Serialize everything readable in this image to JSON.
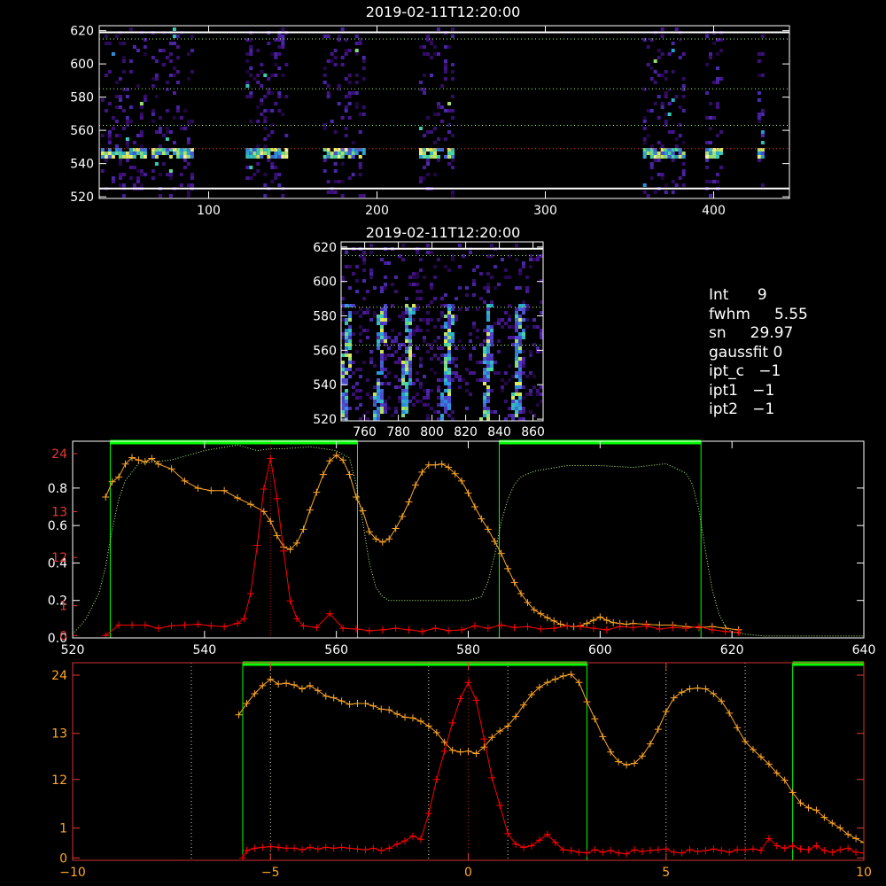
{
  "top_panel": {
    "title": "2019-02-11T12:20:00",
    "x_ticks": [
      "100",
      "200",
      "300",
      "400"
    ],
    "y_ticks": [
      "520",
      "540",
      "560",
      "580",
      "600",
      "620"
    ],
    "xlim": [
      35,
      445
    ],
    "ylim": [
      519,
      623
    ],
    "guide_lines_y": [
      525,
      549,
      563,
      585,
      615
    ],
    "bright_lines_y": [
      525,
      619
    ],
    "exposure_columns": [
      [
        36,
        62
      ],
      [
        66,
        90
      ],
      [
        122,
        146
      ],
      [
        168,
        193
      ],
      [
        225,
        245
      ],
      [
        358,
        383
      ],
      [
        395,
        405
      ],
      [
        426,
        430
      ]
    ],
    "emission_row_y": 548
  },
  "middle_panel": {
    "title": "2019-02-11T12:20:00",
    "x_ticks": [
      "760",
      "780",
      "800",
      "820",
      "840",
      "860"
    ],
    "y_ticks": [
      "520",
      "540",
      "560",
      "580",
      "600",
      "620"
    ],
    "xlim": [
      746,
      866
    ],
    "ylim": [
      519,
      623
    ],
    "guide_lines_y": [
      563,
      585,
      615
    ],
    "bright_lines_y": [
      619
    ]
  },
  "info": {
    "int_label": "Int",
    "int_value": "9",
    "fwhm_label": "fwhm",
    "fwhm_value": "5.55",
    "sn_label": "sn",
    "sn_value": "29.97",
    "gaussfit_label": "gaussfit",
    "gaussfit_value": "0",
    "ipt_c_label": "ipt_c",
    "ipt_c_value": "−1",
    "ipt1_label": "ipt1",
    "ipt1_value": "−1",
    "ipt2_label": "ipt2",
    "ipt2_value": "−1"
  },
  "colors": {
    "background": "#000000",
    "axes": "#ffffff",
    "spectrum_series": "#ff0000",
    "continuum_series": "#ffa726",
    "filter_curve": "#b5ff7a",
    "filter_band": "#00ff00",
    "guide_lines": "#9aff66"
  },
  "chart_data": [
    {
      "type": "line",
      "panel": "spectrum-vs-wavelength",
      "xlim": [
        520,
        640
      ],
      "x_ticks": [
        "520",
        "540",
        "560",
        "580",
        "600",
        "620",
        "640"
      ],
      "ylim_left": [
        0,
        1.05
      ],
      "y_ticks_left": [
        "0.0",
        "0.2",
        "0.4",
        "0.6",
        "0.8"
      ],
      "y_ticks_left_values": [
        0,
        0.2,
        0.4,
        0.6,
        0.8
      ],
      "ylim_right": [
        0,
        24
      ],
      "y_ticks_right": [
        "0",
        "1",
        "12",
        "13",
        "24"
      ],
      "y_ticks_right_values": [
        0.3,
        4,
        10,
        15.7,
        22.9
      ],
      "filter_bands": [
        [
          525.7,
          563.2
        ],
        [
          584.7,
          615.3
        ]
      ],
      "red_marker_x": 550,
      "series": [
        {
          "color": "red",
          "x": [
            525,
            527,
            529,
            531,
            533,
            535,
            537,
            539,
            541,
            543,
            545,
            546,
            547,
            548,
            549,
            550,
            551,
            552,
            553,
            554,
            555,
            557,
            559,
            561,
            563,
            565,
            567,
            569,
            571,
            573,
            575,
            577,
            579,
            581,
            583,
            585,
            587,
            589,
            591,
            593,
            595,
            597,
            599,
            601,
            603,
            605,
            607,
            609,
            611,
            613,
            615,
            617,
            619,
            621
          ],
          "values": [
            0.3,
            1.6,
            1.6,
            1.6,
            1.2,
            1.5,
            1.6,
            1.7,
            1.5,
            1.4,
            1.8,
            2.4,
            5.5,
            11.5,
            18.5,
            22.3,
            17.3,
            10.8,
            4.6,
            2.4,
            1.5,
            1.3,
            3.0,
            1.2,
            1.1,
            0.9,
            1.0,
            1.2,
            1.0,
            0.8,
            1.2,
            0.9,
            1.0,
            1.5,
            1.2,
            1.6,
            1.3,
            1.4,
            1.1,
            1.2,
            1.5,
            1.4,
            1.2,
            1.0,
            1.4,
            1.3,
            1.5,
            1.1,
            1.3,
            1.2,
            1.4,
            1.0,
            0.8,
            0.7
          ]
        },
        {
          "color": "orange",
          "x": [
            525,
            526,
            527,
            528,
            529,
            530,
            531,
            532,
            533,
            535,
            537,
            539,
            541,
            543,
            545,
            547,
            549,
            550,
            551,
            552,
            553,
            554,
            555,
            556,
            557,
            558,
            559,
            560,
            561,
            562,
            563,
            564,
            565,
            566,
            567,
            568,
            569,
            570,
            571,
            572,
            573,
            574,
            575,
            576,
            577,
            578,
            579,
            580,
            581,
            582,
            583,
            584,
            585,
            586,
            587,
            588,
            589,
            590,
            591,
            592,
            593,
            594,
            595,
            596,
            597,
            598,
            599,
            600,
            601,
            602,
            603,
            604,
            605,
            607,
            609,
            611,
            613,
            615,
            617,
            619,
            621
          ],
          "values": [
            17.5,
            19.4,
            20.0,
            21.6,
            22.4,
            22.1,
            21.9,
            22.3,
            21.6,
            21.0,
            19.5,
            18.6,
            18.3,
            18.3,
            17.4,
            16.6,
            15.7,
            14.5,
            12.7,
            11.3,
            11.0,
            11.8,
            13.5,
            15.9,
            18.1,
            20.3,
            22.0,
            22.7,
            22.1,
            20.3,
            17.5,
            15.8,
            13.2,
            12.3,
            11.9,
            12.3,
            13.6,
            15.1,
            16.9,
            19.0,
            20.6,
            21.5,
            21.5,
            21.6,
            21.2,
            20.4,
            19.5,
            18.0,
            16.3,
            14.8,
            13.5,
            12.0,
            10.5,
            8.6,
            6.9,
            5.5,
            4.4,
            3.5,
            3.0,
            2.5,
            2.1,
            1.7,
            1.5,
            1.4,
            1.5,
            1.8,
            2.2,
            2.6,
            2.2,
            1.9,
            1.8,
            1.7,
            1.8,
            1.7,
            1.6,
            1.6,
            1.4,
            1.3,
            1.4,
            1.2,
            1.0
          ]
        },
        {
          "color": "green-dotted",
          "axis": "left",
          "x": [
            520,
            522,
            524,
            525,
            526,
            527,
            528,
            530,
            535,
            540,
            545,
            548,
            550,
            552,
            556,
            560,
            562,
            563,
            564,
            565,
            566,
            567,
            568,
            570,
            575,
            580,
            582,
            583,
            584,
            585,
            586,
            587,
            588,
            590,
            595,
            600,
            605,
            610,
            613,
            614,
            615,
            616,
            617,
            618,
            619,
            620,
            622,
            625,
            630,
            640
          ],
          "values": [
            0.02,
            0.1,
            0.24,
            0.38,
            0.58,
            0.74,
            0.84,
            0.93,
            0.95,
            1.0,
            1.03,
            1.0,
            1.01,
            1.01,
            1.02,
            1.0,
            0.96,
            0.82,
            0.62,
            0.4,
            0.27,
            0.22,
            0.2,
            0.2,
            0.2,
            0.2,
            0.22,
            0.3,
            0.44,
            0.62,
            0.74,
            0.82,
            0.86,
            0.89,
            0.92,
            0.92,
            0.91,
            0.93,
            0.88,
            0.82,
            0.68,
            0.46,
            0.26,
            0.13,
            0.06,
            0.03,
            0.02,
            0.01,
            0.01,
            0.01
          ]
        }
      ]
    },
    {
      "type": "line",
      "panel": "spectrum-vs-offset",
      "xlim": [
        -10,
        10
      ],
      "x_ticks": [
        "−10",
        "−5",
        "0",
        "5",
        "10"
      ],
      "ylim": [
        0,
        24
      ],
      "y_ticks": [
        "0",
        "1",
        "12",
        "13",
        "24"
      ],
      "y_ticks_values": [
        0.3,
        4,
        10,
        15.7,
        22.9
      ],
      "filter_bands": [
        [
          -5.7,
          3.0
        ],
        [
          8.2,
          10
        ]
      ],
      "marker_lines_x": [
        -7,
        -5,
        -1,
        0,
        1,
        5,
        7
      ],
      "series": [
        {
          "color": "red",
          "x": [
            -5.7,
            -5.6,
            -5.4,
            -5.2,
            -5.0,
            -4.8,
            -4.6,
            -4.4,
            -4.2,
            -4.0,
            -3.8,
            -3.6,
            -3.4,
            -3.2,
            -3.0,
            -2.8,
            -2.6,
            -2.4,
            -2.2,
            -2.0,
            -1.8,
            -1.6,
            -1.4,
            -1.2,
            -1.0,
            -0.8,
            -0.6,
            -0.4,
            -0.2,
            0.0,
            0.2,
            0.4,
            0.6,
            0.8,
            1.0,
            1.2,
            1.4,
            1.6,
            1.8,
            2.0,
            2.2,
            2.4,
            2.6,
            2.8,
            3.0,
            3.2,
            3.4,
            3.6,
            3.8,
            4.0,
            4.2,
            4.4,
            4.6,
            4.8,
            5.0,
            5.2,
            5.4,
            5.6,
            5.8,
            6.0,
            6.2,
            6.4,
            6.6,
            6.8,
            7.0,
            7.2,
            7.4,
            7.6,
            7.8,
            8.0,
            8.2,
            8.4,
            8.6,
            8.8,
            9.0,
            9.2,
            9.4,
            9.6,
            9.8,
            10.0
          ],
          "values": [
            0.3,
            1.2,
            1.5,
            1.6,
            1.7,
            1.6,
            1.5,
            1.5,
            1.3,
            1.6,
            1.4,
            1.6,
            1.5,
            1.6,
            1.5,
            1.4,
            1.3,
            1.5,
            1.2,
            1.5,
            2.0,
            2.4,
            3.0,
            2.6,
            5.8,
            10.0,
            13.5,
            17.0,
            20.0,
            22.0,
            19.8,
            15.0,
            10.2,
            6.8,
            3.3,
            2.0,
            1.6,
            1.8,
            2.5,
            3.2,
            2.2,
            1.3,
            1.2,
            1.0,
            0.9,
            1.3,
            1.0,
            1.2,
            0.9,
            0.8,
            1.3,
            1.1,
            1.2,
            1.3,
            1.4,
            1.0,
            0.9,
            1.3,
            1.1,
            1.2,
            1.4,
            1.2,
            1.0,
            1.3,
            1.3,
            1.4,
            1.2,
            2.7,
            1.8,
            1.5,
            1.8,
            1.4,
            1.3,
            1.8,
            1.2,
            1.0,
            1.3,
            1.5,
            1.0,
            0.9
          ]
        },
        {
          "color": "orange",
          "x": [
            -5.8,
            -5.6,
            -5.4,
            -5.2,
            -5.0,
            -4.8,
            -4.6,
            -4.4,
            -4.2,
            -4.0,
            -3.8,
            -3.6,
            -3.4,
            -3.2,
            -3.0,
            -2.8,
            -2.6,
            -2.4,
            -2.2,
            -2.0,
            -1.8,
            -1.6,
            -1.4,
            -1.2,
            -1.0,
            -0.8,
            -0.6,
            -0.4,
            -0.2,
            0.0,
            0.2,
            0.4,
            0.6,
            0.8,
            1.0,
            1.2,
            1.4,
            1.6,
            1.8,
            2.0,
            2.2,
            2.4,
            2.6,
            2.8,
            3.0,
            3.2,
            3.4,
            3.6,
            3.8,
            4.0,
            4.2,
            4.4,
            4.6,
            4.8,
            5.0,
            5.2,
            5.4,
            5.6,
            5.8,
            6.0,
            6.2,
            6.4,
            6.6,
            6.8,
            7.0,
            7.2,
            7.4,
            7.6,
            7.8,
            8.0,
            8.2,
            8.4,
            8.6,
            8.8,
            9.0,
            9.2,
            9.4,
            9.6,
            9.8,
            10.0
          ],
          "values": [
            18.0,
            19.4,
            20.6,
            21.6,
            22.4,
            21.8,
            21.9,
            21.7,
            21.2,
            21.6,
            21.0,
            20.3,
            20.1,
            19.7,
            19.3,
            19.4,
            19.4,
            19.1,
            18.7,
            18.6,
            18.1,
            17.7,
            17.6,
            17.2,
            16.6,
            15.8,
            14.6,
            13.6,
            13.4,
            13.5,
            13.2,
            14.0,
            15.2,
            16.0,
            16.6,
            17.8,
            19.2,
            20.5,
            21.4,
            22.0,
            22.4,
            22.8,
            23.0,
            22.0,
            19.6,
            17.5,
            15.3,
            13.4,
            12.2,
            11.8,
            12.0,
            12.9,
            14.4,
            16.2,
            18.4,
            20.1,
            20.8,
            21.2,
            21.3,
            21.2,
            20.6,
            19.7,
            18.2,
            16.4,
            14.7,
            13.7,
            12.8,
            11.9,
            10.8,
            9.9,
            8.4,
            7.1,
            6.5,
            6.2,
            5.3,
            4.6,
            4.0,
            3.2,
            2.7,
            2.2
          ]
        }
      ]
    }
  ]
}
